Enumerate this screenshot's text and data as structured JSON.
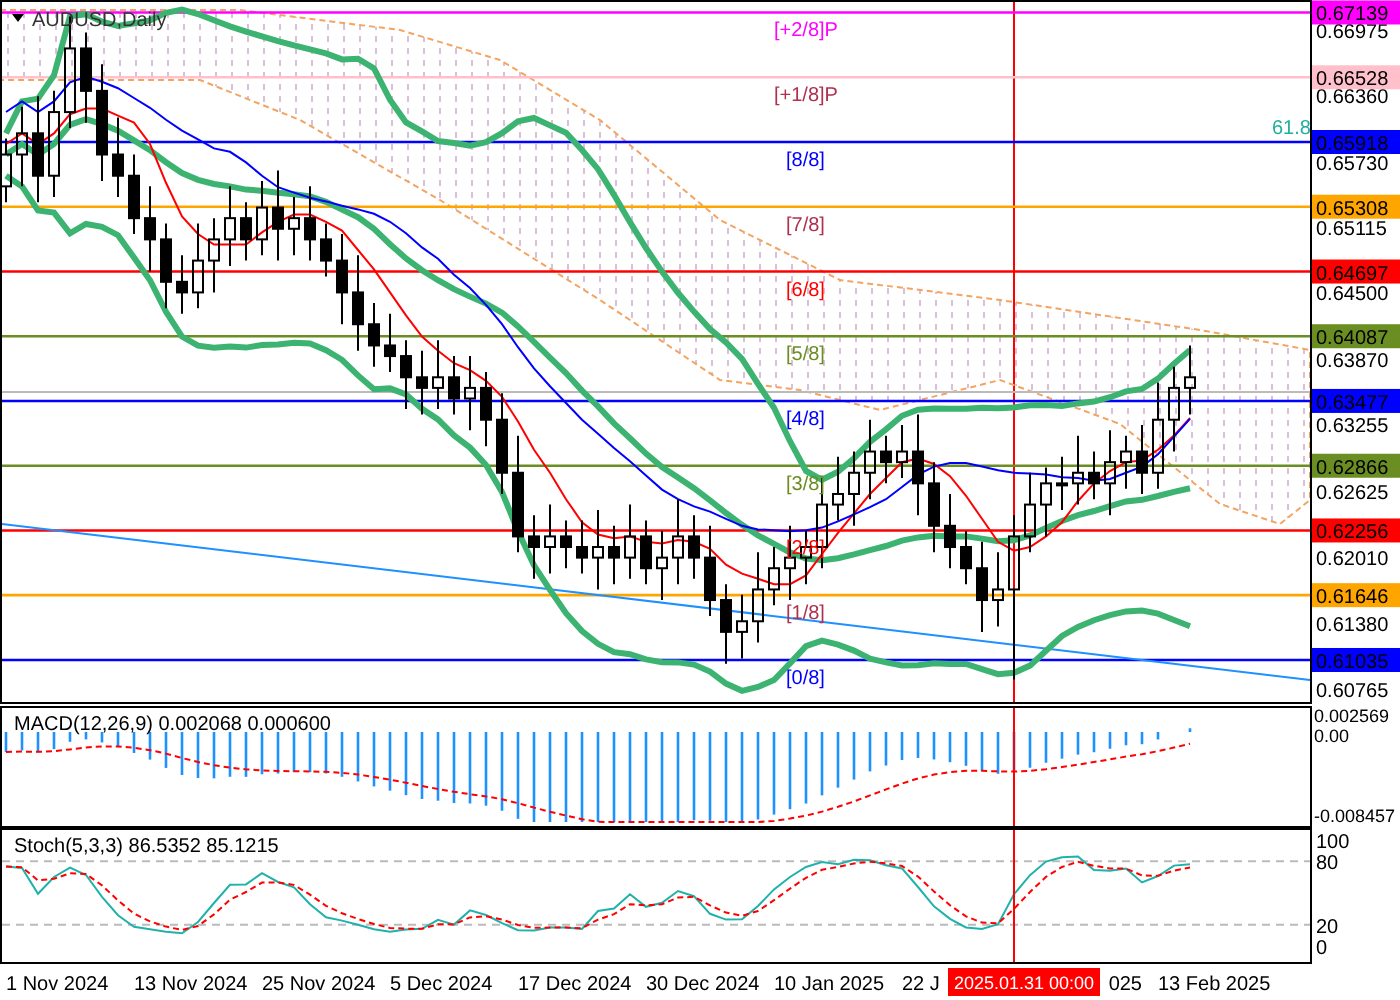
{
  "chart": {
    "symbol": "AUDUSD,Daily",
    "fib_label": "61.8",
    "murrey_levels": [
      {
        "label": "[+2/8]P",
        "price": "0.67139",
        "color": "#ff00ff"
      },
      {
        "label": "[+1/8]P",
        "price": "0.66528",
        "color": "#ffc0cb"
      },
      {
        "label": "[8/8]",
        "price": "0.65918",
        "color": "#0000ff"
      },
      {
        "label": "[7/8]",
        "price": "0.65308",
        "color": "#ffa500"
      },
      {
        "label": "[6/8]",
        "price": "0.64697",
        "color": "#ff0000"
      },
      {
        "label": "[5/8]",
        "price": "0.64087",
        "color": "#6b8e23"
      },
      {
        "label": "[4/8]",
        "price": "0.63477",
        "color": "#0000ff"
      },
      {
        "label": "[3/8]",
        "price": "0.62866",
        "color": "#6b8e23"
      },
      {
        "label": "[2/8]",
        "price": "0.62256",
        "color": "#ff0000"
      },
      {
        "label": "[1/8]",
        "price": "0.61646",
        "color": "#ffa500"
      },
      {
        "label": "[0/8]",
        "price": "0.61035",
        "color": "#0000ff"
      }
    ],
    "price_ticks": [
      "0.66975",
      "0.66360",
      "0.65730",
      "0.65115",
      "0.64500",
      "0.63870",
      "0.63255",
      "0.62625",
      "0.62010",
      "0.61380",
      "0.60765"
    ]
  },
  "macd": {
    "title": "MACD(12,26,9) 0.002068 0.000600",
    "ticks": [
      "0.002569",
      "0.00",
      "-0.008457"
    ]
  },
  "stochastic": {
    "title": "Stoch(5,3,3) 86.5352 85.1215",
    "ticks": [
      "100",
      "80",
      "20",
      "0"
    ]
  },
  "time_axis": {
    "dates": [
      {
        "text": "1 Nov 2024",
        "kind": "full"
      },
      {
        "text": "13 Nov 2024",
        "kind": "full"
      },
      {
        "text": "25 Nov 2024",
        "kind": "full"
      },
      {
        "text": "5 Dec 2024",
        "kind": "full"
      },
      {
        "text": "17 Dec 2024",
        "kind": "full"
      },
      {
        "text": "30 Dec 2024",
        "kind": "full"
      },
      {
        "text": "10 Jan 2025",
        "kind": "full"
      },
      {
        "text": "22 J",
        "kind": "full"
      },
      {
        "text": "025",
        "kind": "tail"
      },
      {
        "text": "13 Feb 2025",
        "kind": "full"
      }
    ],
    "crosshair_label": "2025.01.31 00:00"
  }
}
